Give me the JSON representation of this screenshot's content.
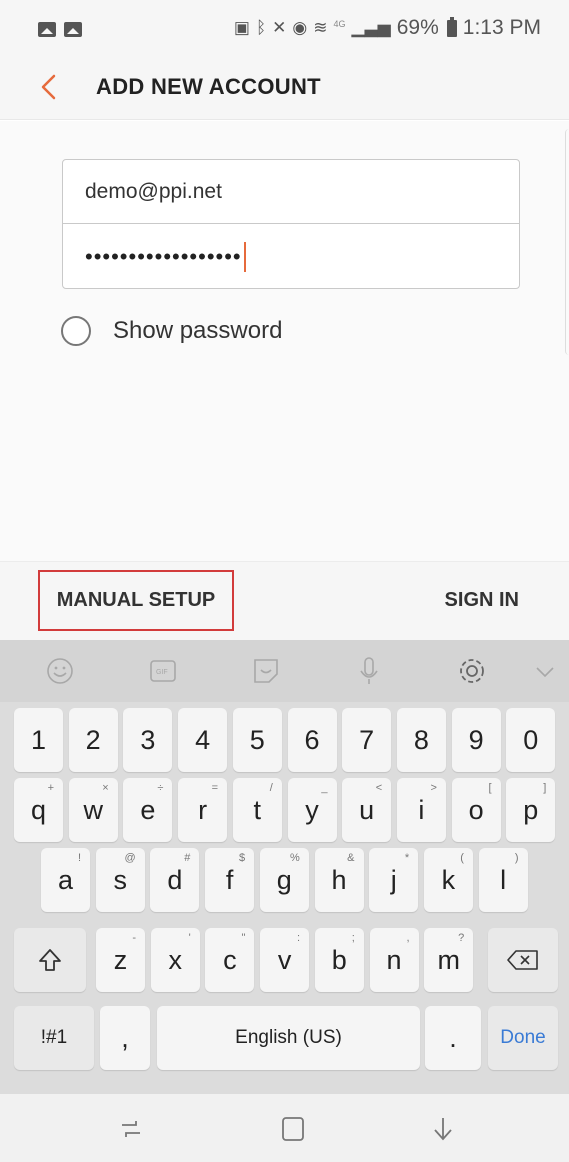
{
  "status_bar": {
    "battery_percent": "69%",
    "time": "1:13 PM",
    "network_small": "4G",
    "icons": [
      "image-icon",
      "image-icon",
      "sim-icon",
      "bluetooth-icon",
      "mute-icon",
      "alarm-icon",
      "wifi-icon",
      "signal-icon",
      "battery-icon"
    ]
  },
  "header": {
    "title": "ADD NEW ACCOUNT",
    "back_icon": "chevron-left-icon",
    "accent": "#e66a3c"
  },
  "form": {
    "email_value": "demo@ppi.net",
    "password_value": "••••••••••••••••••",
    "show_password_label": "Show password"
  },
  "actions": {
    "manual_setup_label": "MANUAL SETUP",
    "sign_in_label": "SIGN IN",
    "highlight_color": "#d23b3b"
  },
  "keyboard": {
    "toolbar_icons": [
      "emoji-icon",
      "gif-icon",
      "sticker-icon",
      "microphone-icon",
      "settings-icon",
      "chevron-down-icon"
    ],
    "row_numbers": [
      "1",
      "2",
      "3",
      "4",
      "5",
      "6",
      "7",
      "8",
      "9",
      "0"
    ],
    "row_top": [
      {
        "key": "q",
        "hint": "+"
      },
      {
        "key": "w",
        "hint": "×"
      },
      {
        "key": "e",
        "hint": "÷"
      },
      {
        "key": "r",
        "hint": "="
      },
      {
        "key": "t",
        "hint": "/"
      },
      {
        "key": "y",
        "hint": "_"
      },
      {
        "key": "u",
        "hint": "<"
      },
      {
        "key": "i",
        "hint": ">"
      },
      {
        "key": "o",
        "hint": "["
      },
      {
        "key": "p",
        "hint": "]"
      }
    ],
    "row_middle": [
      {
        "key": "a",
        "hint": "!"
      },
      {
        "key": "s",
        "hint": "@"
      },
      {
        "key": "d",
        "hint": "#"
      },
      {
        "key": "f",
        "hint": "$"
      },
      {
        "key": "g",
        "hint": "%"
      },
      {
        "key": "h",
        "hint": "&"
      },
      {
        "key": "j",
        "hint": "*"
      },
      {
        "key": "k",
        "hint": "("
      },
      {
        "key": "l",
        "hint": ")"
      }
    ],
    "row_bottom": [
      {
        "key": "z",
        "hint": "-"
      },
      {
        "key": "x",
        "hint": "'"
      },
      {
        "key": "c",
        "hint": "\""
      },
      {
        "key": "v",
        "hint": ":"
      },
      {
        "key": "b",
        "hint": ";"
      },
      {
        "key": "n",
        "hint": ","
      },
      {
        "key": "m",
        "hint": "?"
      }
    ],
    "symbols_label": "!#1",
    "comma_label": ",",
    "space_label": "English (US)",
    "period_label": ".",
    "done_label": "Done",
    "done_color": "#3a7bd5"
  },
  "nav_bar": {
    "icons": [
      "recent-apps-icon",
      "home-icon",
      "back-icon"
    ]
  }
}
